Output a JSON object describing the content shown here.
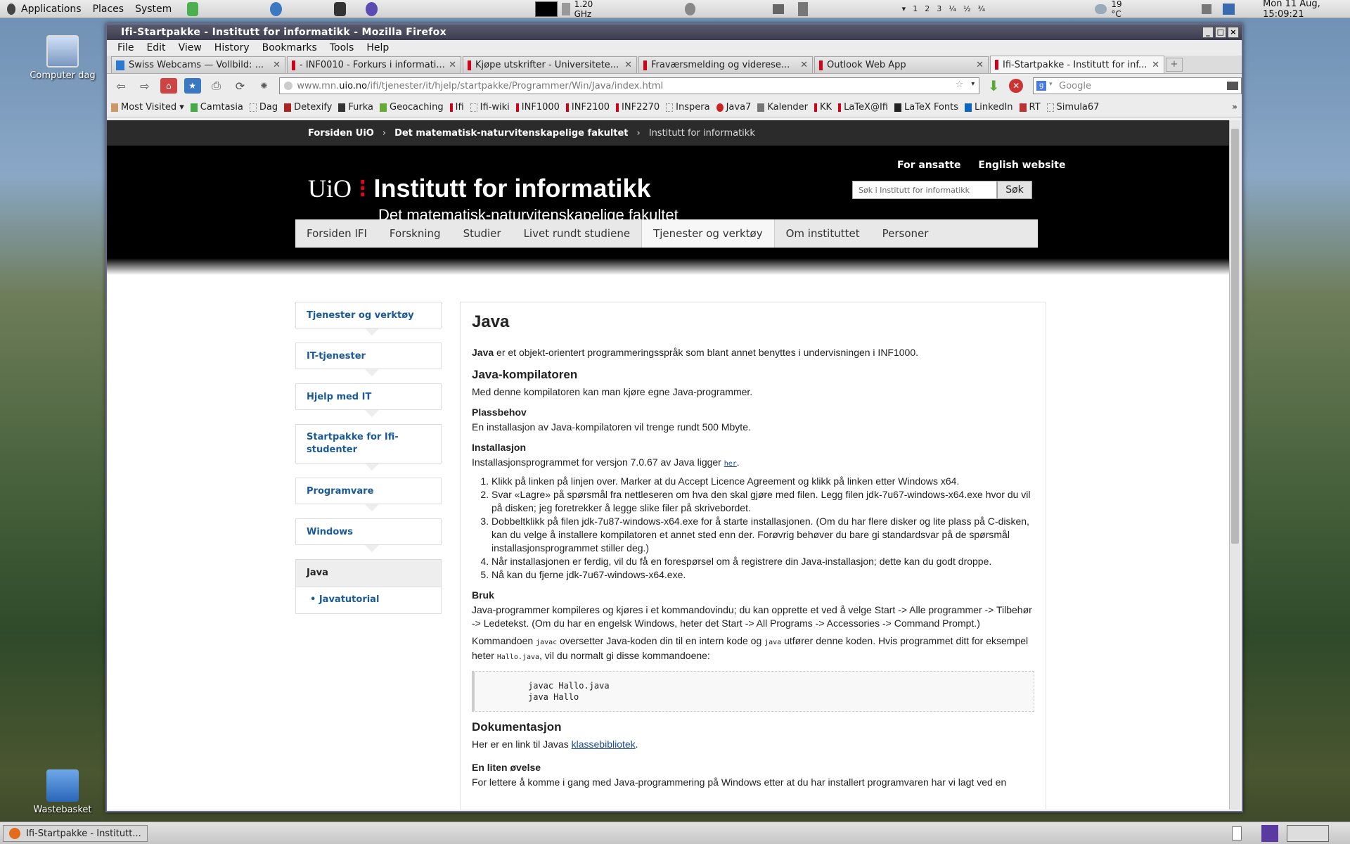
{
  "panel": {
    "menus": [
      "Applications",
      "Places",
      "System"
    ],
    "cpu": "1.20 GHz",
    "workspaces": [
      "1",
      "2",
      "3",
      "¼",
      "½",
      "¾"
    ],
    "weather": "19 °C",
    "clock": "Mon 11 Aug, 15:09:21"
  },
  "desktop": {
    "icons": [
      "Computer",
      "Wastebasket"
    ],
    "partial_label": "dag"
  },
  "window": {
    "title": "Ifi-Startpakke - Institutt for informatikk - Mozilla Firefox",
    "menu": [
      "File",
      "Edit",
      "View",
      "History",
      "Bookmarks",
      "Tools",
      "Help"
    ],
    "tabs": [
      {
        "label": "Swiss Webcams — Vollbild: ..."
      },
      {
        "label": "- INF0010 - Forkurs i informati..."
      },
      {
        "label": "Kjøpe utskrifter - Universitete..."
      },
      {
        "label": "Fraværsmelding og viderese..."
      },
      {
        "label": "Outlook Web App"
      },
      {
        "label": "Ifi-Startpakke - Institutt for inf..."
      }
    ],
    "url_prefix": "www.mn.",
    "url_host": "uio.no",
    "url_path": "/ifi/tjenester/it/hjelp/startpakke/Programmer/Win/Java/index.html",
    "search_placeholder": "Google",
    "bookmarks": [
      "Most Visited ▾",
      "Camtasia",
      "Dag",
      "Detexify",
      "Furka",
      "Geocaching",
      "Ifi",
      "Ifi-wiki",
      "INF1000",
      "INF2100",
      "INF2270",
      "Inspera",
      "Java7",
      "Kalender",
      "KK",
      "LaTeX@Ifi",
      "LaTeX Fonts",
      "LinkedIn",
      "RT",
      "Simula67",
      "»"
    ]
  },
  "page": {
    "breadcrumb": [
      "Forsiden UiO",
      "›",
      "Det matematisk-naturvitenskapelige fakultet",
      "›",
      "Institutt for informatikk"
    ],
    "logo_uio": "UiO",
    "logo_dot": "⁝",
    "logo_title": "Institutt for informatikk",
    "faculty": "Det matematisk-naturvitenskapelige fakultet",
    "top_links": [
      "For ansatte",
      "English website"
    ],
    "search_placeholder": "Søk i Institutt for informatikk",
    "search_button": "Søk",
    "nav": [
      "Forsiden IFI",
      "Forskning",
      "Studier",
      "Livet rundt studiene",
      "Tjenester og verktøy",
      "Om instituttet",
      "Personer"
    ],
    "sidebar": [
      "Tjenester og verktøy",
      "IT-tjenester",
      "Hjelp med IT",
      "Startpakke for Ifi-studenter",
      "Programvare",
      "Windows",
      "Java",
      "Javatutorial"
    ],
    "h1": "Java",
    "intro_bold": "Java",
    "intro": " er et objekt-orientert programmeringsspråk som blant annet benyttes i undervisningen i INF1000.",
    "h_komp": "Java-kompilatoren",
    "p_komp": "Med denne kompilatoren kan man kjøre egne Java-programmer.",
    "h_plass": "Plassbehov",
    "p_plass": "En installasjon av Java-kompilatoren vil trenge rundt 500 Mbyte.",
    "h_inst": "Installasjon",
    "p_inst": "Installasjonsprogrammet for versjon 7.0.67 av Java ligger ",
    "p_inst_link": "her",
    "steps": [
      "Klikk på linken på linjen over. Marker at du Accept Licence Agreement og klikk på linken etter Windows x64.",
      "Svar «Lagre» på spørsmål fra nettleseren om hva den skal gjøre med filen. Legg filen jdk-7u67-windows-x64.exe hvor du vil på disken; jeg foretrekker å legge slike filer på skrivebordet.",
      "Dobbeltklikk på filen jdk-7u87-windows-x64.exe for å starte installasjonen. (Om du har flere disker og lite plass på C-disken, kan du velge å installere kompilatoren et annet sted enn der. Forøvrig behøver du bare gi standardsvar på de spørsmål installasjonsprogrammet stiller deg.)",
      "Når installasjonen er ferdig, vil du få en forespørsel om å registrere din Java-installasjon; dette kan du godt droppe.",
      "Nå kan du fjerne jdk-7u67-windows-x64.exe."
    ],
    "h_bruk": "Bruk",
    "p_bruk": "Java-programmer kompileres og kjøres i et kommandovindu; du kan opprette et ved å velge Start -> Alle programmer -> Tilbehør -> Ledetekst. (Om du har en engelsk Windows, heter det Start -> All Programs -> Accessories -> Command Prompt.)",
    "p_kmd_a": "Kommandoen ",
    "p_kmd_javac": "javac",
    "p_kmd_b": " oversetter Java-koden din til en intern kode og ",
    "p_kmd_java": "java",
    "p_kmd_c": " utfører denne koden. Hvis programmet ditt for eksempel heter ",
    "p_kmd_file": "Hallo.java",
    "p_kmd_d": ", vil du normalt gi disse kommandoene:",
    "code": "javac Hallo.java\njava Hallo",
    "h_dok": "Dokumentasjon",
    "p_dok": "Her er en link til Javas ",
    "p_dok_link": "klassebibliotek",
    "p_dok_end": ".",
    "h_ovelse": "En liten øvelse",
    "p_ovelse": "For lettere å komme i gang med Java-programmering på Windows etter at du har installert programvaren har vi lagt ved en"
  },
  "taskbar": {
    "item": "Ifi-Startpakke - Institutt..."
  }
}
